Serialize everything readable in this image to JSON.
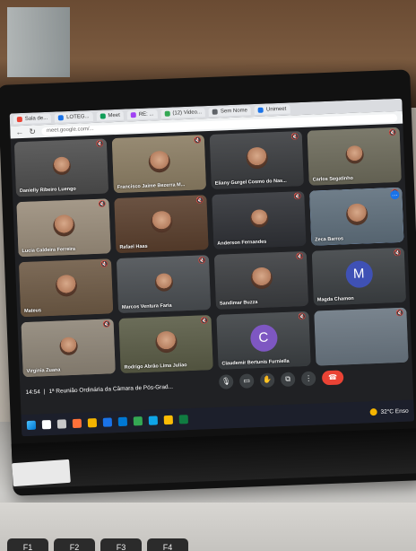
{
  "browser": {
    "tabs": [
      {
        "label": "Sala de...",
        "color": "#ea4335"
      },
      {
        "label": "LOTEG...",
        "color": "#1a73e8"
      },
      {
        "label": "Meet",
        "color": "#0f9d58"
      },
      {
        "label": "RE: ...",
        "color": "#a142f4"
      },
      {
        "label": "(12) Video...",
        "color": "#34a853"
      },
      {
        "label": "Sem Nome",
        "color": "#5f6368"
      },
      {
        "label": "Unimeet",
        "color": "#1a73e8"
      }
    ],
    "url": "meet.google.com/..."
  },
  "participants": [
    {
      "name": "Danielly Ribeiro Luengo",
      "type": "video",
      "bg": "#4d4d4d",
      "active": false
    },
    {
      "name": "Francisco Jaime Bezerra M...",
      "type": "video",
      "bg": "#8b7d63",
      "active": false
    },
    {
      "name": "Eliany Gurgel Cosmo do Nas...",
      "type": "video",
      "bg": "#3a3c3f",
      "active": false
    },
    {
      "name": "Carlos Segatinho",
      "type": "video",
      "bg": "#6d6b5b",
      "active": false
    },
    {
      "name": "Lucia Caldeira Ferreira",
      "type": "video",
      "bg": "#9a8d7b",
      "active": false
    },
    {
      "name": "Rafael Haas",
      "type": "video",
      "bg": "#5a3f2d",
      "active": false
    },
    {
      "name": "Anderson Fernandes",
      "type": "video",
      "bg": "#2f3136",
      "active": false
    },
    {
      "name": "Zeca Barros",
      "type": "video",
      "bg": "#5f6f7c",
      "active": true
    },
    {
      "name": "Mateus",
      "type": "video",
      "bg": "#6e5a45",
      "active": false
    },
    {
      "name": "Marcos Ventura Faria",
      "type": "video",
      "bg": "#4a4e52",
      "active": false
    },
    {
      "name": "Sandimar Buzza",
      "type": "video",
      "bg": "#3b3d40",
      "active": false
    },
    {
      "name": "Magda Chamon",
      "type": "avatar",
      "letter": "M",
      "bg": "#3c4043",
      "avatar_color": "#3f51b5",
      "active": false
    },
    {
      "name": "Virginia Zuana",
      "type": "video",
      "bg": "#8e8577",
      "active": false
    },
    {
      "name": "Rodrigo Abrão Lima Juliao",
      "type": "video",
      "bg": "#5a5c46",
      "active": false
    },
    {
      "name": "Claudemir Bertunis Furniella",
      "type": "avatar",
      "letter": "C",
      "bg": "#3c4043",
      "avatar_color": "#7e57c2",
      "active": false
    },
    {
      "name": "",
      "type": "video",
      "bg": "#6a7681",
      "active": false
    }
  ],
  "meeting": {
    "time": "14:54",
    "separator": "|",
    "title": "1ª Reunião Ordinária da Câmara de Pós-Grad..."
  },
  "controls": [
    {
      "name": "mic-button",
      "glyph": "🎙"
    },
    {
      "name": "camera-button",
      "glyph": "▭"
    },
    {
      "name": "raise-hand-button",
      "glyph": "✋"
    },
    {
      "name": "present-button",
      "glyph": "⧉"
    },
    {
      "name": "more-options-button",
      "glyph": "⋮"
    },
    {
      "name": "end-call-button",
      "glyph": "☎"
    }
  ],
  "taskbar": {
    "icons": [
      {
        "name": "search-icon",
        "color": "#ffffff"
      },
      {
        "name": "task-view-icon",
        "color": "#c8c8c8"
      },
      {
        "name": "firefox-icon",
        "color": "#ff7139"
      },
      {
        "name": "folder-icon",
        "color": "#f4b400"
      },
      {
        "name": "store-icon",
        "color": "#1a73e8"
      },
      {
        "name": "mail-icon",
        "color": "#0078d4"
      },
      {
        "name": "calendar-icon",
        "color": "#34a853"
      },
      {
        "name": "edge-icon",
        "color": "#0ea5e9"
      },
      {
        "name": "chrome-icon",
        "color": "#fbbc05"
      },
      {
        "name": "excel-icon",
        "color": "#107c41"
      }
    ],
    "weather": "32°C Enso"
  }
}
